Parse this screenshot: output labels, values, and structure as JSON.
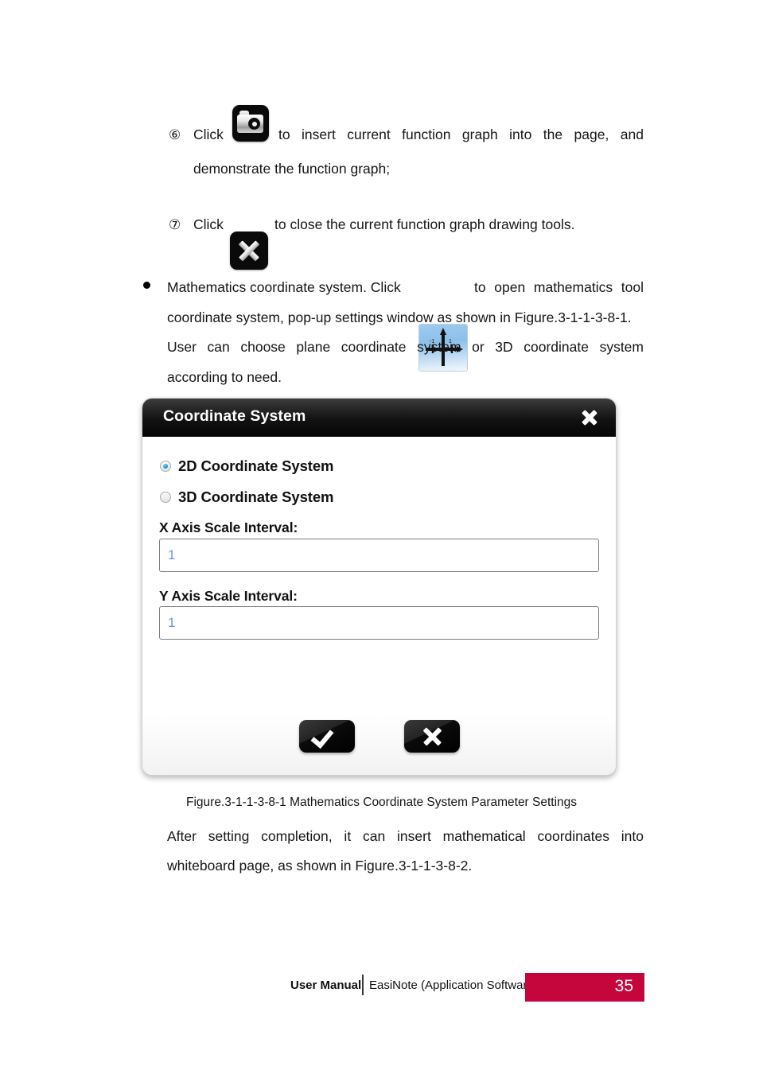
{
  "document": {
    "steps": [
      {
        "marker": "⑥",
        "icon": "camera-icon",
        "lines": [
          "Click",
          "to   insert   current   function   graph   into   the   page,   and",
          "demonstrate the function graph;"
        ],
        "text_before_icon": "Click",
        "text_after_icon_line1": "to insert current function graph into the page, and",
        "text_line2": "demonstrate the function graph;"
      },
      {
        "marker": "⑦",
        "icon": "close-x-icon",
        "text_before_icon": "Click",
        "text_after_icon_line1": "to close the current function graph drawing tools."
      }
    ],
    "bullet_paragraph": {
      "bullet": "●",
      "line1_before_icon": "Mathematics   coordinate   system.   Click",
      "icon": "coordinate-axes-icon",
      "line1_after_icon": "to   open   mathematics   tool",
      "line2": "coordinate system, pop-up settings window as shown in Figure.3-1-1-3-8-1.",
      "line3": "User   can   choose   plane   coordinate   system   or   3D   coordinate   system",
      "line4": "according to need."
    },
    "figure_caption": "Figure.3-1-1-3-8-1 Mathematics Coordinate System Parameter Settings",
    "closing_paragraph": {
      "line1": "After   setting   completion,   it   can   insert   mathematical   coordinates   into",
      "line2": "whiteboard page, as shown in Figure.3-1-1-3-8-2."
    }
  },
  "dialog": {
    "title": "Coordinate System",
    "close_icon": "close-icon",
    "options": [
      {
        "label": "2D Coordinate System",
        "selected": true
      },
      {
        "label": "3D Coordinate System",
        "selected": false
      }
    ],
    "fields": [
      {
        "label": "X Axis Scale Interval:",
        "value": "1",
        "placeholder": "1"
      },
      {
        "label": "Y Axis Scale Interval:",
        "value": "1",
        "placeholder": "1"
      }
    ],
    "buttons": [
      {
        "name": "confirm",
        "icon": "checkmark-icon"
      },
      {
        "name": "cancel",
        "icon": "x-icon"
      }
    ]
  },
  "footer": {
    "manual_label": "User Manual",
    "product_label": "EasiNote (Application Software)",
    "page_number": "35",
    "badge_color": "#c4063c"
  }
}
